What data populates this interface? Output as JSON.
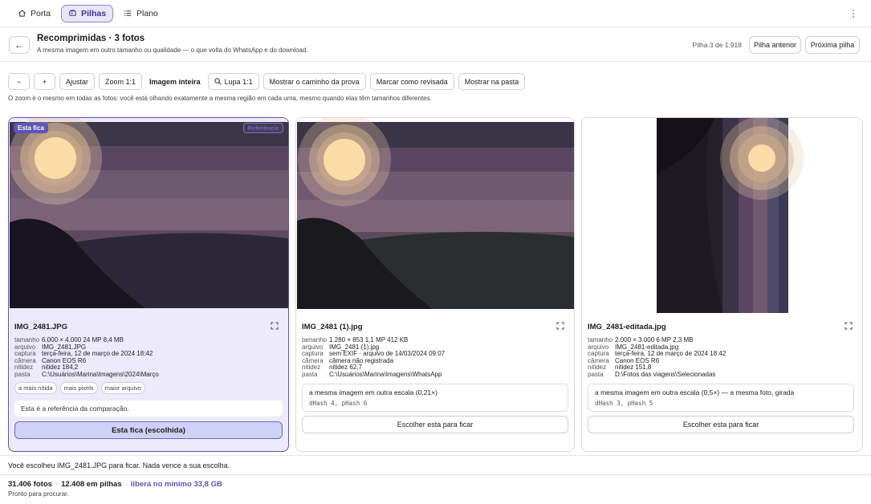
{
  "nav": {
    "items": [
      {
        "label": "Porta",
        "icon": "home-icon"
      },
      {
        "label": "Pilhas",
        "icon": "stack-icon",
        "active": true
      },
      {
        "label": "Plano",
        "icon": "list-icon"
      }
    ],
    "menu_icon": "kebab-icon"
  },
  "header": {
    "back_icon": "arrow-left-icon",
    "title": "Recomprimidas · 3 fotos",
    "subtitle": "A mesma imagem em outro tamanho ou qualidade — o que volta do WhatsApp e do download.",
    "stack_info": "Pilha 3 de 1.918",
    "prev_label": "Pilha anterior",
    "next_label": "Próxima pilha"
  },
  "toolbar": {
    "zoom_out": "−",
    "zoom_in": "+",
    "fit": "Ajustar",
    "zoom_1": "Zoom 1:1",
    "whole": "Imagem inteira",
    "loupe": "Lupa 1:1",
    "proof": "Mostrar o caminho da prova",
    "reviewed": "Marcar como revisada",
    "folder": "Mostrar na pasta",
    "note": "O zoom é o mesmo em todas as fotos: você está olhando exatamente a mesma região em cada uma, mesmo quando elas têm tamanhos diferentes."
  },
  "cards": [
    {
      "badge_keep": "Esta fica",
      "badge_ref": "Referência",
      "filename": "IMG_2481.JPG",
      "meta": [
        {
          "k": "tamanho",
          "v": "6.000 × 4.000 24 MP 8,4 MB"
        },
        {
          "k": "arquivo",
          "v": "IMG_2481.JPG"
        },
        {
          "k": "captura",
          "v": "terça-feira, 12 de março de 2024 18:42"
        },
        {
          "k": "câmera",
          "v": "Canon EOS R6"
        },
        {
          "k": "nitidez",
          "v": "nitidez 184,2"
        },
        {
          "k": "pasta",
          "v": "C:\\Usuários\\Marina\\Imagens\\2024\\Março"
        }
      ],
      "tags": [
        "a mais nítida",
        "mais pixels",
        "maior arquivo"
      ],
      "ref_note": "Esta é a referência da comparação.",
      "keep_label": "Esta fica (escolhida)"
    },
    {
      "filename": "IMG_2481 (1).jpg",
      "meta": [
        {
          "k": "tamanho",
          "v": "1.280 × 853 1,1 MP 412 KB"
        },
        {
          "k": "arquivo",
          "v": "IMG_2481 (1).jpg"
        },
        {
          "k": "captura",
          "v": "sem EXIF · arquivo de 14/03/2024 09:07"
        },
        {
          "k": "câmera",
          "v": "câmera não registrada"
        },
        {
          "k": "nitidez",
          "v": "nitidez 62,7"
        },
        {
          "k": "pasta",
          "v": "C:\\Usuários\\Marina\\Imagens\\WhatsApp"
        }
      ],
      "sim_text": "a mesma imagem em outra escala (0,21×)",
      "sim_hash": "dHash 4, pHash 6",
      "choose_label": "Escolher esta para ficar"
    },
    {
      "filename": "IMG_2481-editada.jpg",
      "meta": [
        {
          "k": "tamanho",
          "v": "2.000 × 3.000 6 MP 2,3 MB"
        },
        {
          "k": "arquivo",
          "v": "IMG_2481-editada.jpg"
        },
        {
          "k": "captura",
          "v": "terça-feira, 12 de março de 2024 18:42"
        },
        {
          "k": "câmera",
          "v": "Canon EOS R6"
        },
        {
          "k": "nitidez",
          "v": "nitidez 151,8"
        },
        {
          "k": "pasta",
          "v": "D:\\Fotos das viagens\\Selecionadas"
        }
      ],
      "sim_text": "a mesma imagem em outra escala (0,5×) — a mesma foto, girada",
      "sim_hash": "dHash 3, pHash 5",
      "choose_label": "Escolher esta para ficar"
    }
  ],
  "footer": {
    "choice": "Você escolheu IMG_2481.JPG para ficar. Nada vence a sua escolha.",
    "photos": "31.406 fotos",
    "stacks": "12.408 em pilhas",
    "free": "libera no mínimo 33,8 GB",
    "status": "Pronto para procurar."
  },
  "colors": {
    "accent": "#5b55b8",
    "chosen_bg": "#eceafb"
  }
}
